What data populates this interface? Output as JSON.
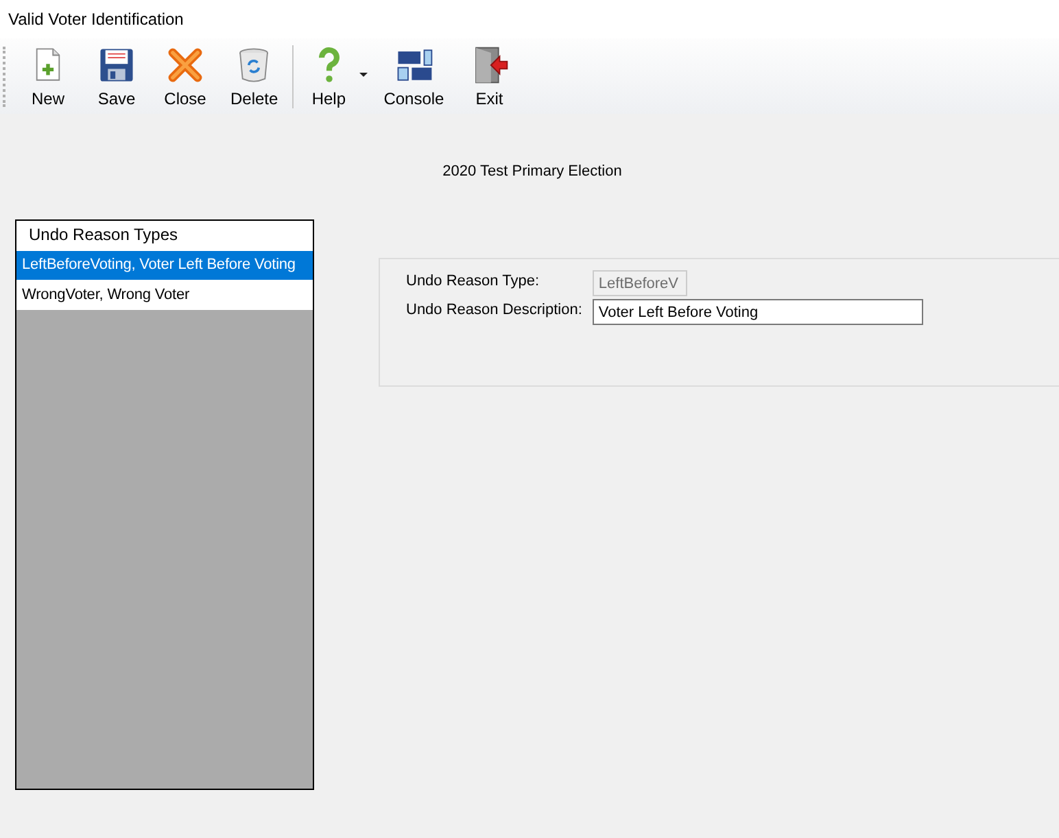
{
  "window": {
    "title": "Valid Voter Identification"
  },
  "toolbar": [
    {
      "kind": "button",
      "label": "New"
    },
    {
      "kind": "button",
      "label": "Save"
    },
    {
      "kind": "button",
      "label": "Close"
    },
    {
      "kind": "button",
      "label": "Delete"
    },
    {
      "kind": "separator"
    },
    {
      "kind": "dropdown",
      "label": "Help"
    },
    {
      "kind": "button",
      "label": "Console"
    },
    {
      "kind": "button",
      "label": "Exit"
    }
  ],
  "election": "2020 Test Primary Election",
  "list": {
    "header": "Undo Reason Types",
    "items": [
      {
        "label": "LeftBeforeVoting, Voter Left Before Voting",
        "selected": true
      },
      {
        "label": "WrongVoter, Wrong Voter",
        "selected": false
      }
    ]
  },
  "form": {
    "fields": [
      {
        "label": "Undo Reason Type:",
        "value": "LeftBeforeV",
        "disabled": true
      },
      {
        "label": "Undo Reason Description:",
        "value": "Voter Left Before Voting",
        "disabled": false
      }
    ]
  }
}
